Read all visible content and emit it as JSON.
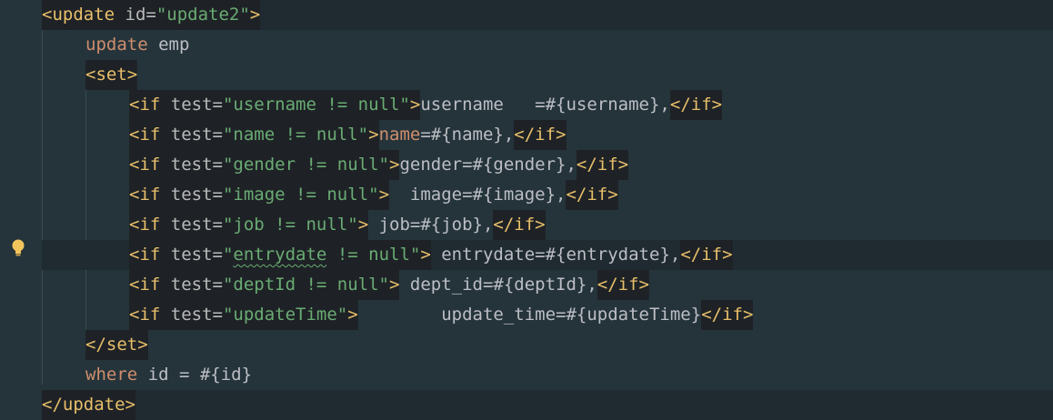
{
  "editor": {
    "lines": [
      {
        "indent": 0,
        "segments": [
          {
            "t": "<update ",
            "c": "tag",
            "b": true
          },
          {
            "t": "id=",
            "c": "attr",
            "b": true
          },
          {
            "t": "\"update2\"",
            "c": "str",
            "b": true
          },
          {
            "t": ">",
            "c": "tag",
            "b": true
          }
        ]
      },
      {
        "indent": 1,
        "segments": [
          {
            "t": "update",
            "c": "kw",
            "b": false
          },
          {
            "t": " emp",
            "c": "txt",
            "b": false
          }
        ]
      },
      {
        "indent": 1,
        "segments": [
          {
            "t": "<set>",
            "c": "tag",
            "b": true
          }
        ]
      },
      {
        "indent": 2,
        "segments": [
          {
            "t": "<if ",
            "c": "tag",
            "b": true
          },
          {
            "t": "test=",
            "c": "attr",
            "b": true
          },
          {
            "t": "\"username != null\"",
            "c": "str",
            "b": true
          },
          {
            "t": ">",
            "c": "tag",
            "b": true
          },
          {
            "t": "username   =#{username},",
            "c": "txt",
            "b": false
          },
          {
            "t": "</if>",
            "c": "tag",
            "b": true
          }
        ]
      },
      {
        "indent": 2,
        "segments": [
          {
            "t": "<if ",
            "c": "tag",
            "b": true
          },
          {
            "t": "test=",
            "c": "attr",
            "b": true
          },
          {
            "t": "\"name != null\"",
            "c": "str",
            "b": true
          },
          {
            "t": ">",
            "c": "tag",
            "b": true
          },
          {
            "t": "name",
            "c": "kw",
            "b": false
          },
          {
            "t": "=#{name},",
            "c": "txt",
            "b": false
          },
          {
            "t": "</if>",
            "c": "tag",
            "b": true
          }
        ]
      },
      {
        "indent": 2,
        "segments": [
          {
            "t": "<if ",
            "c": "tag",
            "b": true
          },
          {
            "t": "test=",
            "c": "attr",
            "b": true
          },
          {
            "t": "\"gender != null\"",
            "c": "str",
            "b": true
          },
          {
            "t": ">",
            "c": "tag",
            "b": true
          },
          {
            "t": "gender=#{gender},",
            "c": "txt",
            "b": false
          },
          {
            "t": "</if>",
            "c": "tag",
            "b": true
          }
        ]
      },
      {
        "indent": 2,
        "segments": [
          {
            "t": "<if ",
            "c": "tag",
            "b": true
          },
          {
            "t": "test=",
            "c": "attr",
            "b": true
          },
          {
            "t": "\"image != null\"",
            "c": "str",
            "b": true
          },
          {
            "t": ">",
            "c": "tag",
            "b": true
          },
          {
            "t": "  image=#{image},",
            "c": "txt",
            "b": false
          },
          {
            "t": "</if>",
            "c": "tag",
            "b": true
          }
        ]
      },
      {
        "indent": 2,
        "segments": [
          {
            "t": "<if ",
            "c": "tag",
            "b": true
          },
          {
            "t": "test=",
            "c": "attr",
            "b": true
          },
          {
            "t": "\"job != null\"",
            "c": "str",
            "b": true
          },
          {
            "t": ">",
            "c": "tag",
            "b": true
          },
          {
            "t": " job=#{job},",
            "c": "txt",
            "b": false
          },
          {
            "t": "</if>",
            "c": "tag",
            "b": true
          }
        ]
      },
      {
        "indent": 2,
        "current": true,
        "segments": [
          {
            "t": "<if ",
            "c": "tag",
            "b": true
          },
          {
            "t": "test=",
            "c": "attr",
            "b": true
          },
          {
            "t": "\"",
            "c": "str",
            "b": true
          },
          {
            "t": "entrydate",
            "c": "str",
            "b": true,
            "sq": true
          },
          {
            "t": " != null\"",
            "c": "str",
            "b": true
          },
          {
            "t": ">",
            "c": "tag",
            "b": true
          },
          {
            "t": " entrydate=#{entrydate},",
            "c": "txt",
            "b": false
          },
          {
            "t": "</if>",
            "c": "tag",
            "b": true
          }
        ]
      },
      {
        "indent": 2,
        "segments": [
          {
            "t": "<if ",
            "c": "tag",
            "b": true
          },
          {
            "t": "test=",
            "c": "attr",
            "b": true
          },
          {
            "t": "\"deptId != null\"",
            "c": "str",
            "b": true
          },
          {
            "t": ">",
            "c": "tag",
            "b": true
          },
          {
            "t": " dept_id=#{deptId},",
            "c": "txt",
            "b": false
          },
          {
            "t": "</if>",
            "c": "tag",
            "b": true
          }
        ]
      },
      {
        "indent": 2,
        "segments": [
          {
            "t": "<if ",
            "c": "tag",
            "b": true
          },
          {
            "t": "test=",
            "c": "attr",
            "b": true
          },
          {
            "t": "\"updateTime\"",
            "c": "str",
            "b": true
          },
          {
            "t": ">",
            "c": "tag",
            "b": true
          },
          {
            "t": "        update_time=#{updateTime}",
            "c": "txt",
            "b": false
          },
          {
            "t": "</if>",
            "c": "tag",
            "b": true
          }
        ]
      },
      {
        "indent": 1,
        "segments": [
          {
            "t": "</set>",
            "c": "tag",
            "b": true
          }
        ]
      },
      {
        "indent": 1,
        "segments": [
          {
            "t": "where",
            "c": "kw",
            "b": false
          },
          {
            "t": " id = #{id}",
            "c": "txt",
            "b": false
          }
        ]
      },
      {
        "indent": 0,
        "segments": [
          {
            "t": "</update>",
            "c": "tag",
            "b": true
          }
        ]
      }
    ]
  },
  "gutter": {
    "intention_icon": "lightbulb-icon"
  },
  "colors": {
    "background": "#25343b",
    "tag": "#e8bf6a",
    "attribute": "#bababa",
    "string": "#6aab73",
    "keyword": "#cf8e6d",
    "text": "#bcbec4",
    "tag_block": "#1e2226"
  }
}
